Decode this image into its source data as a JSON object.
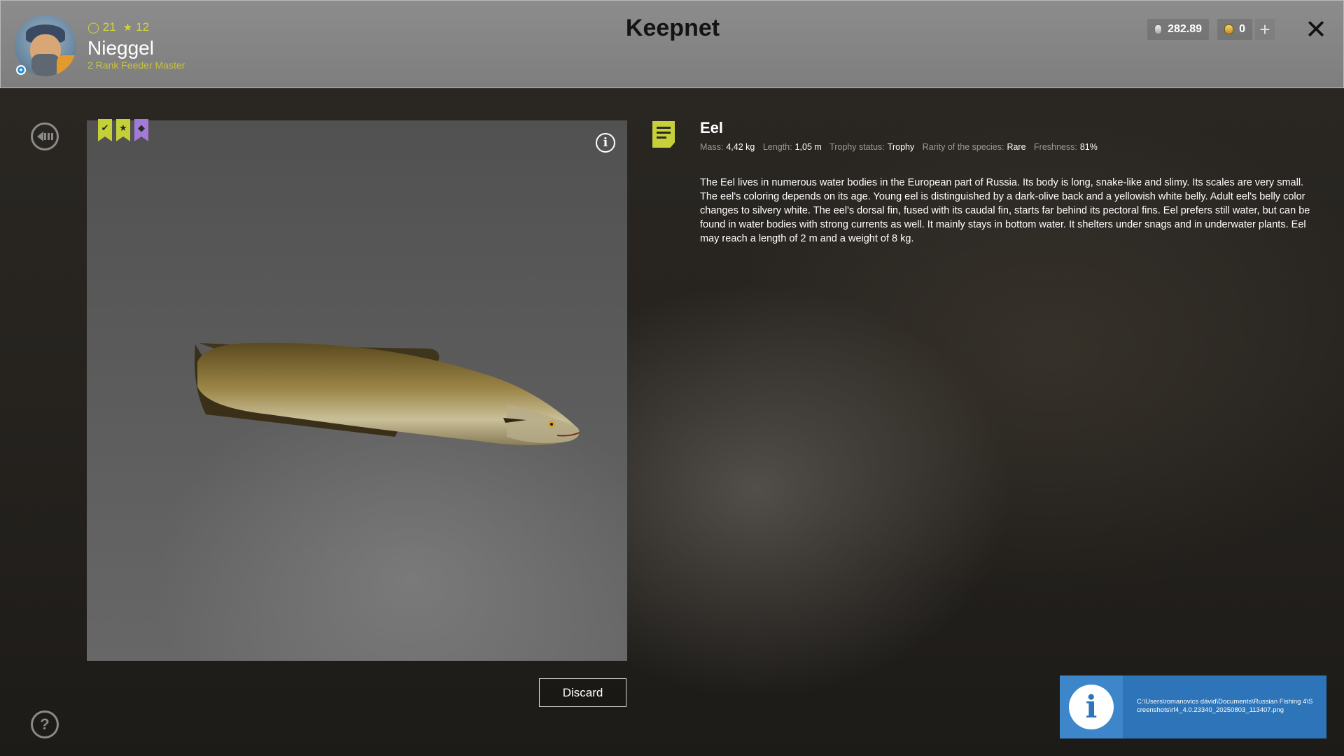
{
  "header": {
    "title": "Keepnet",
    "player": {
      "name": "Nieggel",
      "rank": "2 Rank Feeder Master",
      "level": "21",
      "stars": "12"
    },
    "currency": {
      "silver": "282.89",
      "gold": "0"
    },
    "add_label": "+",
    "close_label": "✕"
  },
  "fish": {
    "name": "Eel",
    "badges": [
      "check",
      "star",
      "diamond"
    ],
    "meta": {
      "mass_label": "Mass:",
      "mass": "4,42 kg",
      "length_label": "Length:",
      "length": "1,05 m",
      "trophy_label": "Trophy status:",
      "trophy": "Trophy",
      "rarity_label": "Rarity of the species:",
      "rarity": "Rare",
      "freshness_label": "Freshness:",
      "freshness": "81%"
    },
    "description": "The Eel lives in numerous water bodies in the European part of Russia. Its body is long, snake-like and slimy. Its scales are very small. The eel's coloring depends on its age. Young eel is distinguished by a dark-olive back and a yellowish white belly. Adult eel's belly color changes to silvery white. The eel's dorsal fin, fused with its caudal fin, starts far behind its pectoral fins. Eel prefers still water, but can be found in water bodies with strong currents as well. It mainly stays in bottom water. It shelters under snags and in underwater plants. Eel may reach a length of 2 m and a weight of 8 kg."
  },
  "actions": {
    "discard_label": "Discard"
  },
  "notification": {
    "path": "C:\\Users\\romanovics dávid\\Documents\\Russian Fishing 4\\Screenshots\\rf4_4.0.23340_20250803_113407.png"
  },
  "colors": {
    "accent_lime": "#c3d037",
    "accent_violet": "#a27ad8",
    "notification_blue": "#2d74b8",
    "header_bg": "#8c8c8c"
  },
  "icons": {
    "back": "back-arrow-icon",
    "help": "help-icon",
    "info": "info-icon",
    "close": "close-icon",
    "document": "document-icon"
  }
}
